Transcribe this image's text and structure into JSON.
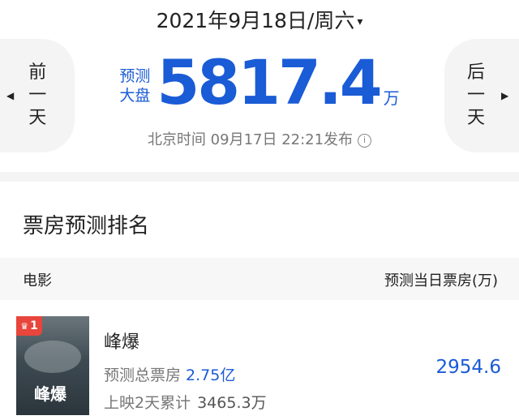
{
  "date_bar": {
    "date": "2021年9月18日/周六",
    "caret": "▾"
  },
  "nav": {
    "prev": {
      "arrow": "◀",
      "line1": "前",
      "line2": "一",
      "line3": "天"
    },
    "next": {
      "arrow": "▶",
      "line1": "后",
      "line2": "一",
      "line3": "天"
    }
  },
  "forecast": {
    "tag_line1": "预测",
    "tag_line2": "大盘",
    "value": "5817.4",
    "unit": "万",
    "release_text": "北京时间 09月17日 22:21发布",
    "info_glyph": "i"
  },
  "ranking": {
    "title": "票房预测排名",
    "col_movie": "电影",
    "col_box": "预测当日票房(万)",
    "movies": [
      {
        "rank": "1",
        "crown": "♛",
        "poster_title": "峰爆",
        "name": "峰爆",
        "total_label": "预测总票房",
        "total_value": "2.75亿",
        "cum_label": "上映2天累计",
        "cum_value": "3465.3万",
        "day_box": "2954.6"
      }
    ]
  },
  "colors": {
    "accent": "#1a5bd6",
    "badge": "#e8453c",
    "panel": "#f4f4f5"
  }
}
